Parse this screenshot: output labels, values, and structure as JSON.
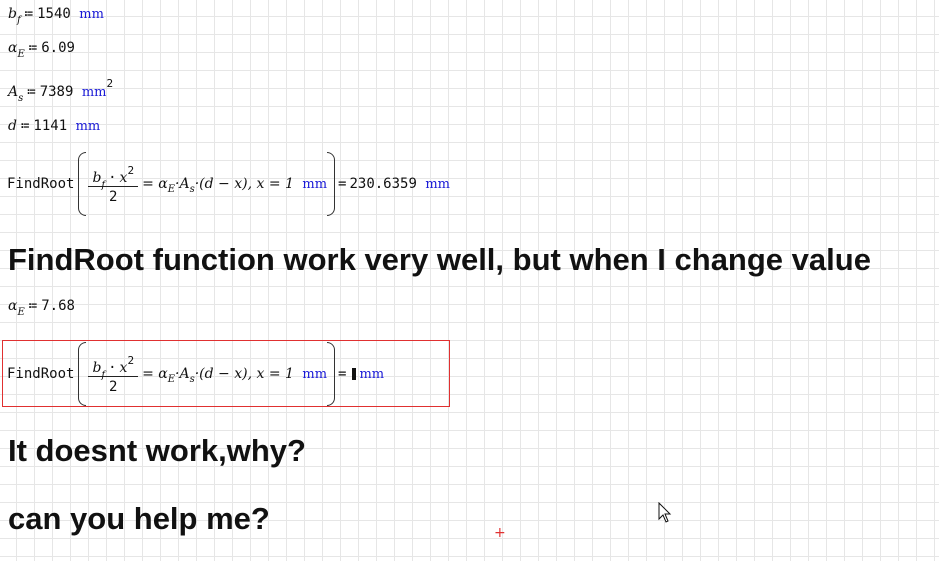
{
  "defs": {
    "bf": {
      "var": "b",
      "sub": "f",
      "op": "≔",
      "value": "1540",
      "unit": "mm"
    },
    "alphaE": {
      "var": "α",
      "sub": "E",
      "op": "≔",
      "value": "6.09"
    },
    "As": {
      "var": "A",
      "sub": "s",
      "op": "≔",
      "value": "7389",
      "unit": "mm",
      "exp": "2"
    },
    "d": {
      "var": "d",
      "op": "≔",
      "value": "1141",
      "unit": "mm"
    },
    "alphaE2": {
      "var": "α",
      "sub": "E",
      "op": "≔",
      "value": "7.68"
    }
  },
  "findroot1": {
    "func": "FindRoot",
    "num_b": "b",
    "num_bsub": "f",
    "num_dot": "·",
    "num_x": "x",
    "num_exp": "2",
    "den": "2",
    "rhs": "= α",
    "rhs_sub": "E",
    "rhs_rest": "·A",
    "rhs_sub2": "s",
    "rhs_tail": "·(d − x), x = 1",
    "guess_unit": "mm",
    "result_eq": "=",
    "result": "230.6359",
    "result_unit": "mm"
  },
  "findroot2": {
    "func": "FindRoot",
    "num_b": "b",
    "num_bsub": "f",
    "num_dot": "·",
    "num_x": "x",
    "num_exp": "2",
    "den": "2",
    "rhs": "= α",
    "rhs_sub": "E",
    "rhs_rest": "·A",
    "rhs_sub2": "s",
    "rhs_tail": "·(d − x), x = 1",
    "guess_unit": "mm",
    "result_eq": "=",
    "result_unit": "mm"
  },
  "text": {
    "line1": "FindRoot function work very well, but when I change value",
    "line2": "It doesnt work,why?",
    "line3": "can you help me?"
  },
  "colors": {
    "unit": "#1a1ad6",
    "error_box": "#e03030",
    "grid": "#e6e6e6"
  },
  "icons": {
    "pointer": "mouse-pointer-icon",
    "crosshair": "crosshair-icon"
  }
}
